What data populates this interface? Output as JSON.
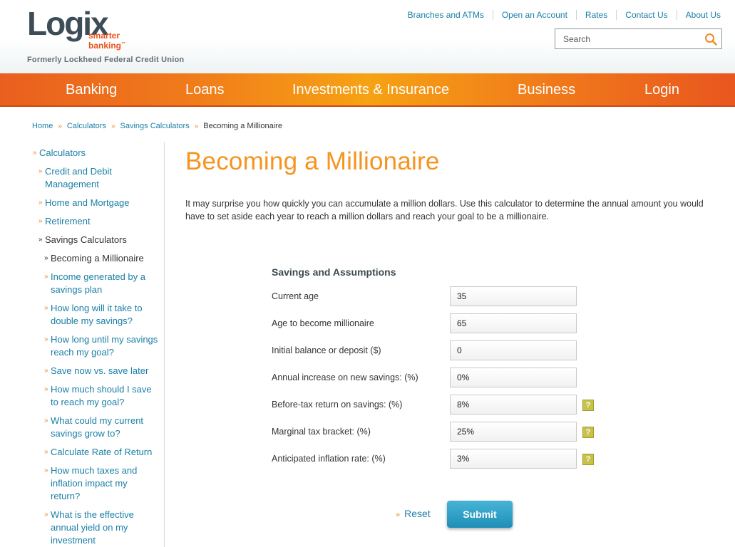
{
  "brand": {
    "logo_word": "Logix",
    "logo_tag_1": "smarter",
    "logo_tag_2": "banking",
    "logo_tm": "™",
    "formerly": "Formerly Lockheed Federal Credit Union",
    "accent": "#f7931e",
    "link_color": "#1a7fa6"
  },
  "top_links": [
    "Branches and ATMs",
    "Open an Account",
    "Rates",
    "Contact Us",
    "About Us"
  ],
  "search": {
    "placeholder": "Search",
    "icon": "search-icon"
  },
  "nav": [
    "Banking",
    "Loans",
    "Investments & Insurance",
    "Business",
    "Login"
  ],
  "breadcrumb": {
    "items": [
      "Home",
      "Calculators",
      "Savings Calculators"
    ],
    "current": "Becoming a Millionaire"
  },
  "sidebar": {
    "items": [
      {
        "label": "Calculators"
      },
      {
        "label": "Credit and Debit\nManagement"
      },
      {
        "label": "Home and Mortgage"
      },
      {
        "label": "Retirement"
      },
      {
        "label": "Savings Calculators"
      },
      {
        "label": "Becoming a Millionaire"
      },
      {
        "label": "Income generated by a\nsavings plan"
      },
      {
        "label": "How long will it take to\ndouble my savings?"
      },
      {
        "label": "How long until my savings\nreach my goal?"
      },
      {
        "label": "Save now vs. save later"
      },
      {
        "label": "How much should I save\nto reach my goal?"
      },
      {
        "label": "What could my current\nsavings grow to?"
      },
      {
        "label": "Calculate Rate of Return"
      },
      {
        "label": "How much taxes and\ninflation impact my\nreturn?"
      },
      {
        "label": "What is the effective\nannual yield on my\ninvestment"
      }
    ]
  },
  "main": {
    "title": "Becoming a Millionaire",
    "intro": "It may surprise you how quickly you can accumulate a million dollars. Use this calculator to determine the annual amount you would have to set aside each year to reach a million dollars and reach your goal to be a millionaire."
  },
  "form": {
    "title": "Savings and Assumptions",
    "rows": [
      {
        "label": "Current age",
        "value": "35",
        "help": false
      },
      {
        "label": "Age to become millionaire",
        "value": "65",
        "help": false
      },
      {
        "label": "Initial balance or deposit ($)",
        "value": "0",
        "help": false
      },
      {
        "label": "Annual increase on new savings: (%)",
        "value": "0%",
        "help": false
      },
      {
        "label": "Before-tax return on savings: (%)",
        "value": "8%",
        "help": true
      },
      {
        "label": "Marginal tax bracket: (%)",
        "value": "25%",
        "help": true
      },
      {
        "label": "Anticipated inflation rate: (%)",
        "value": "3%",
        "help": true
      }
    ],
    "help_glyph": "?",
    "reset_label": "Reset",
    "submit_label": "Submit"
  }
}
